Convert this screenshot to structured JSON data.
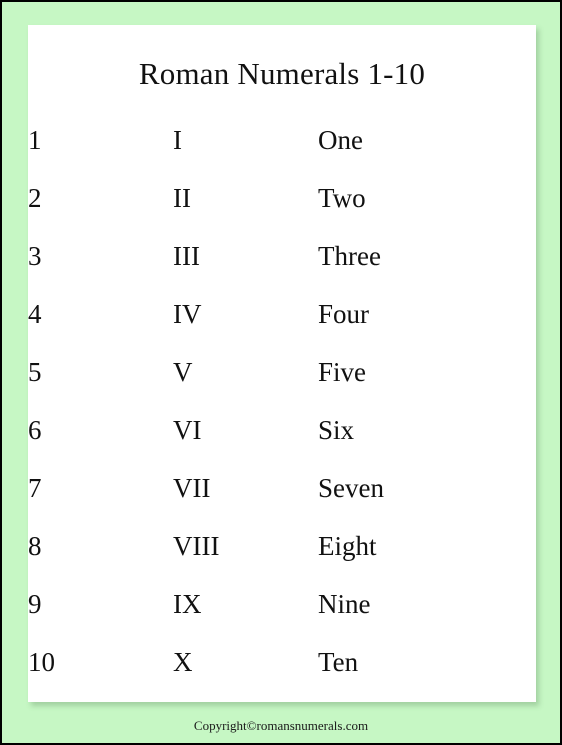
{
  "poster": {
    "background_color": "#c6f7c4",
    "card_color": "#ffffff",
    "border_color": "#000000",
    "text_color": "#111111",
    "title": "Roman Numerals 1-10",
    "footer": "Copyright©romansnumerals.com"
  },
  "table": {
    "columns": [
      "arabic",
      "roman",
      "word"
    ],
    "rows": [
      {
        "arabic": "1",
        "roman": "I",
        "word": "One"
      },
      {
        "arabic": "2",
        "roman": "II",
        "word": "Two"
      },
      {
        "arabic": "3",
        "roman": "III",
        "word": "Three"
      },
      {
        "arabic": "4",
        "roman": "IV",
        "word": "Four"
      },
      {
        "arabic": "5",
        "roman": "V",
        "word": "Five"
      },
      {
        "arabic": "6",
        "roman": "VI",
        "word": "Six"
      },
      {
        "arabic": "7",
        "roman": "VII",
        "word": "Seven"
      },
      {
        "arabic": "8",
        "roman": "VIII",
        "word": "Eight"
      },
      {
        "arabic": "9",
        "roman": "IX",
        "word": "Nine"
      },
      {
        "arabic": "10",
        "roman": "X",
        "word": "Ten"
      }
    ]
  }
}
